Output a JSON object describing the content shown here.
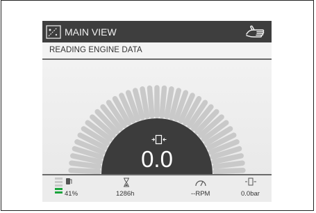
{
  "header": {
    "title": "MAIN VIEW",
    "view_icon": "main-view-icon",
    "hand_icon": "hand-icon"
  },
  "subheader": {
    "status": "READING ENGINE DATA"
  },
  "gauge": {
    "value": "0.0",
    "level": 0,
    "icon": "engine-hub-icon"
  },
  "footer": {
    "fuel": {
      "value": "41%",
      "level_percent": 41
    },
    "hours": {
      "value": "1286h"
    },
    "rpm": {
      "value": "--RPM"
    },
    "pressure": {
      "value": "0.0bar"
    }
  },
  "colors": {
    "header": "#3e3e3e",
    "hub": "#3c3c3c",
    "fuel_green": "#1aa43c",
    "segment": "#c9c9c9"
  }
}
